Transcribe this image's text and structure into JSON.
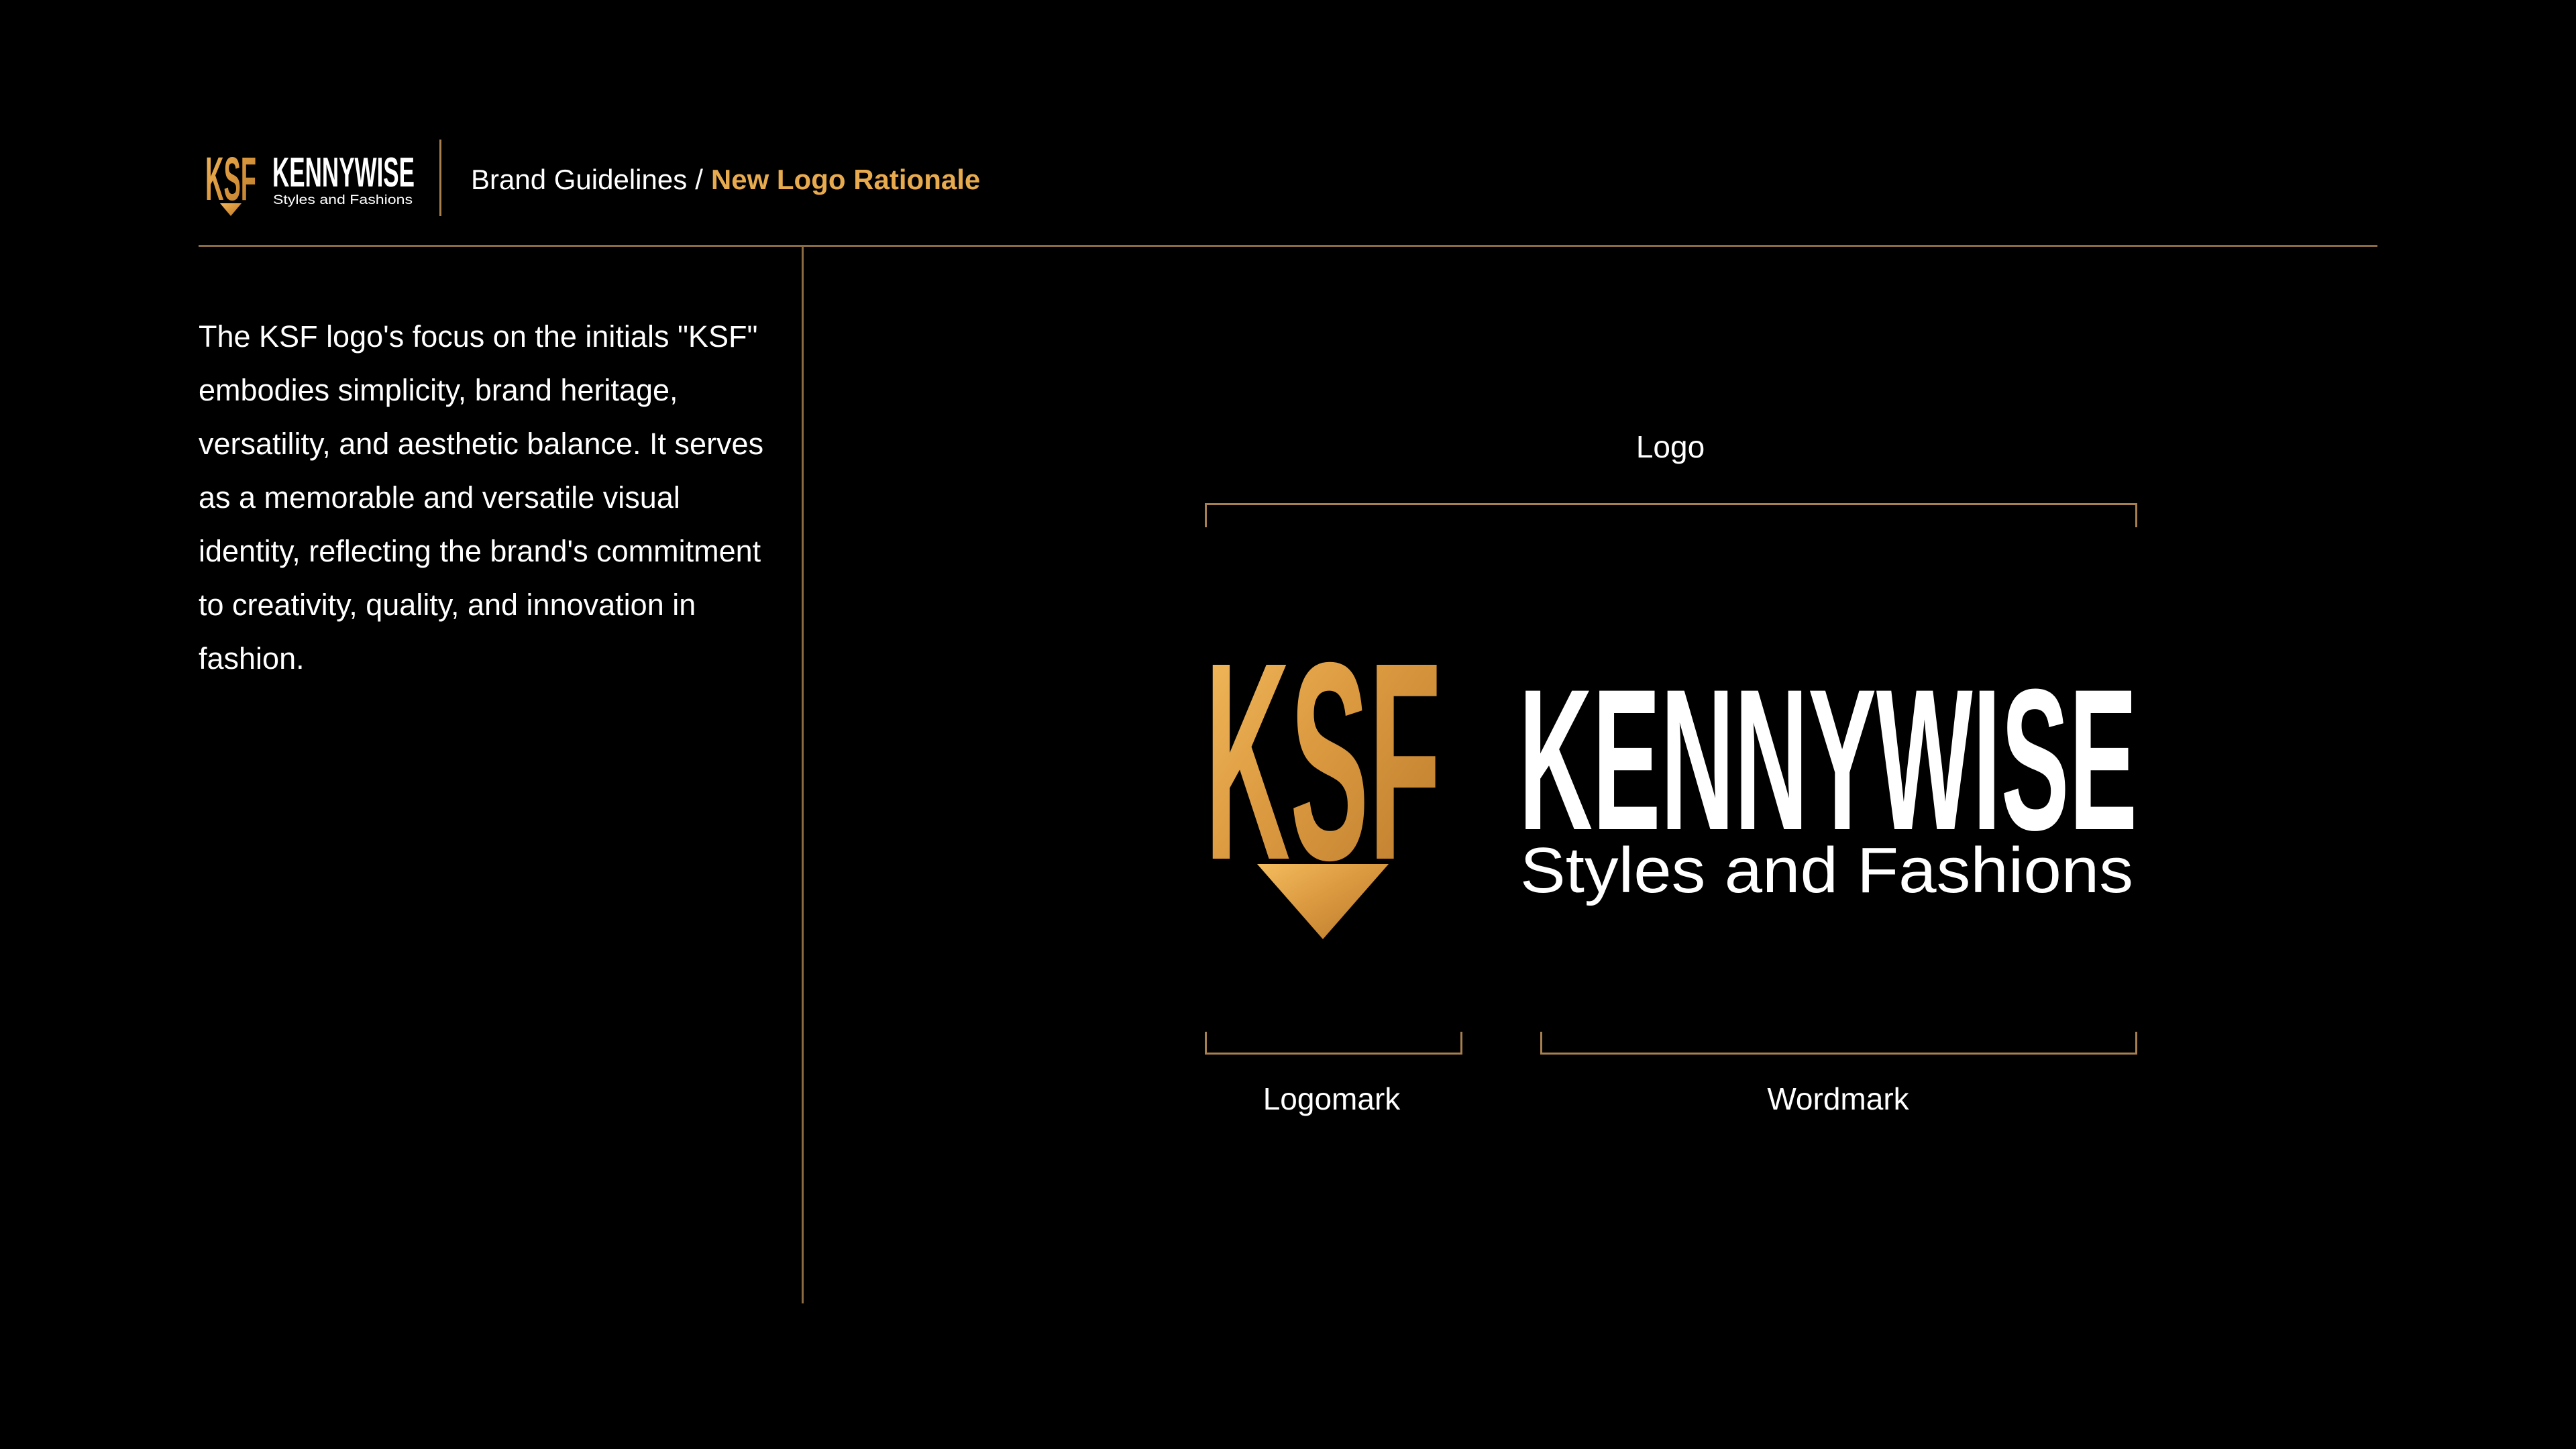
{
  "header": {
    "brand_name": "KENNYWISE",
    "brand_tagline": "Styles and Fashions",
    "monogram": "KSF",
    "breadcrumb": {
      "root": "Brand Guidelines",
      "separator": "/",
      "current": "New Logo Rationale"
    }
  },
  "rationale": {
    "text": "The KSF logo's focus on the initials \"KSF\" embodies simplicity, brand heritage, versatility, and aesthetic balance. It serves as a memorable and versatile visual identity, reflecting the brand's commitment to creativity, quality, and innovation in fashion."
  },
  "diagram": {
    "logo_label": "Logo",
    "logomark_label": "Logomark",
    "wordmark_label": "Wordmark",
    "wordmark_name": "KENNYWISE",
    "wordmark_tagline": "Styles and Fashions",
    "monogram": "KSF"
  },
  "colors": {
    "background": "#000000",
    "accent_gold": "#e8aa4e",
    "rule_gold": "#8c6a42",
    "text": "#ffffff"
  }
}
